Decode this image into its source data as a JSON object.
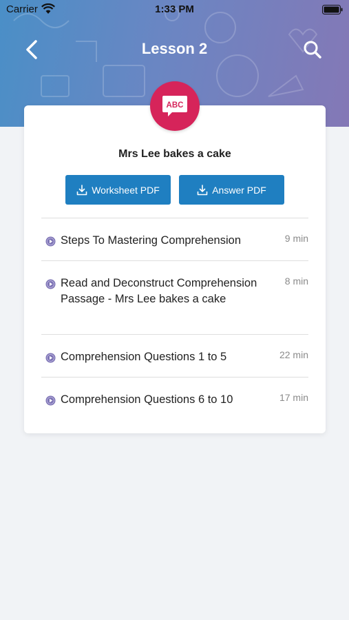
{
  "status_bar": {
    "carrier": "Carrier",
    "time": "1:33 PM"
  },
  "nav": {
    "title": "Lesson 2",
    "back_icon": "chevron-left-icon",
    "search_icon": "search-icon"
  },
  "lesson": {
    "badge_text": "ABC",
    "title": "Mrs Lee bakes a cake",
    "worksheet_label": "Worksheet PDF",
    "answer_label": "Answer PDF"
  },
  "items": [
    {
      "title": "Steps To Mastering Comprehension",
      "duration": "9 min"
    },
    {
      "title": "Read and Deconstruct Comprehension Passage - Mrs Lee bakes a cake",
      "duration": "8 min"
    },
    {
      "title": "Comprehension Questions 1 to 5",
      "duration": "22 min"
    },
    {
      "title": "Comprehension Questions 6 to 10",
      "duration": "17 min"
    }
  ],
  "colors": {
    "header_start": "#4a8fc7",
    "header_end": "#8478b6",
    "badge": "#d6245a",
    "button": "#1f7fc1",
    "play_icon": "#7d73b5"
  }
}
